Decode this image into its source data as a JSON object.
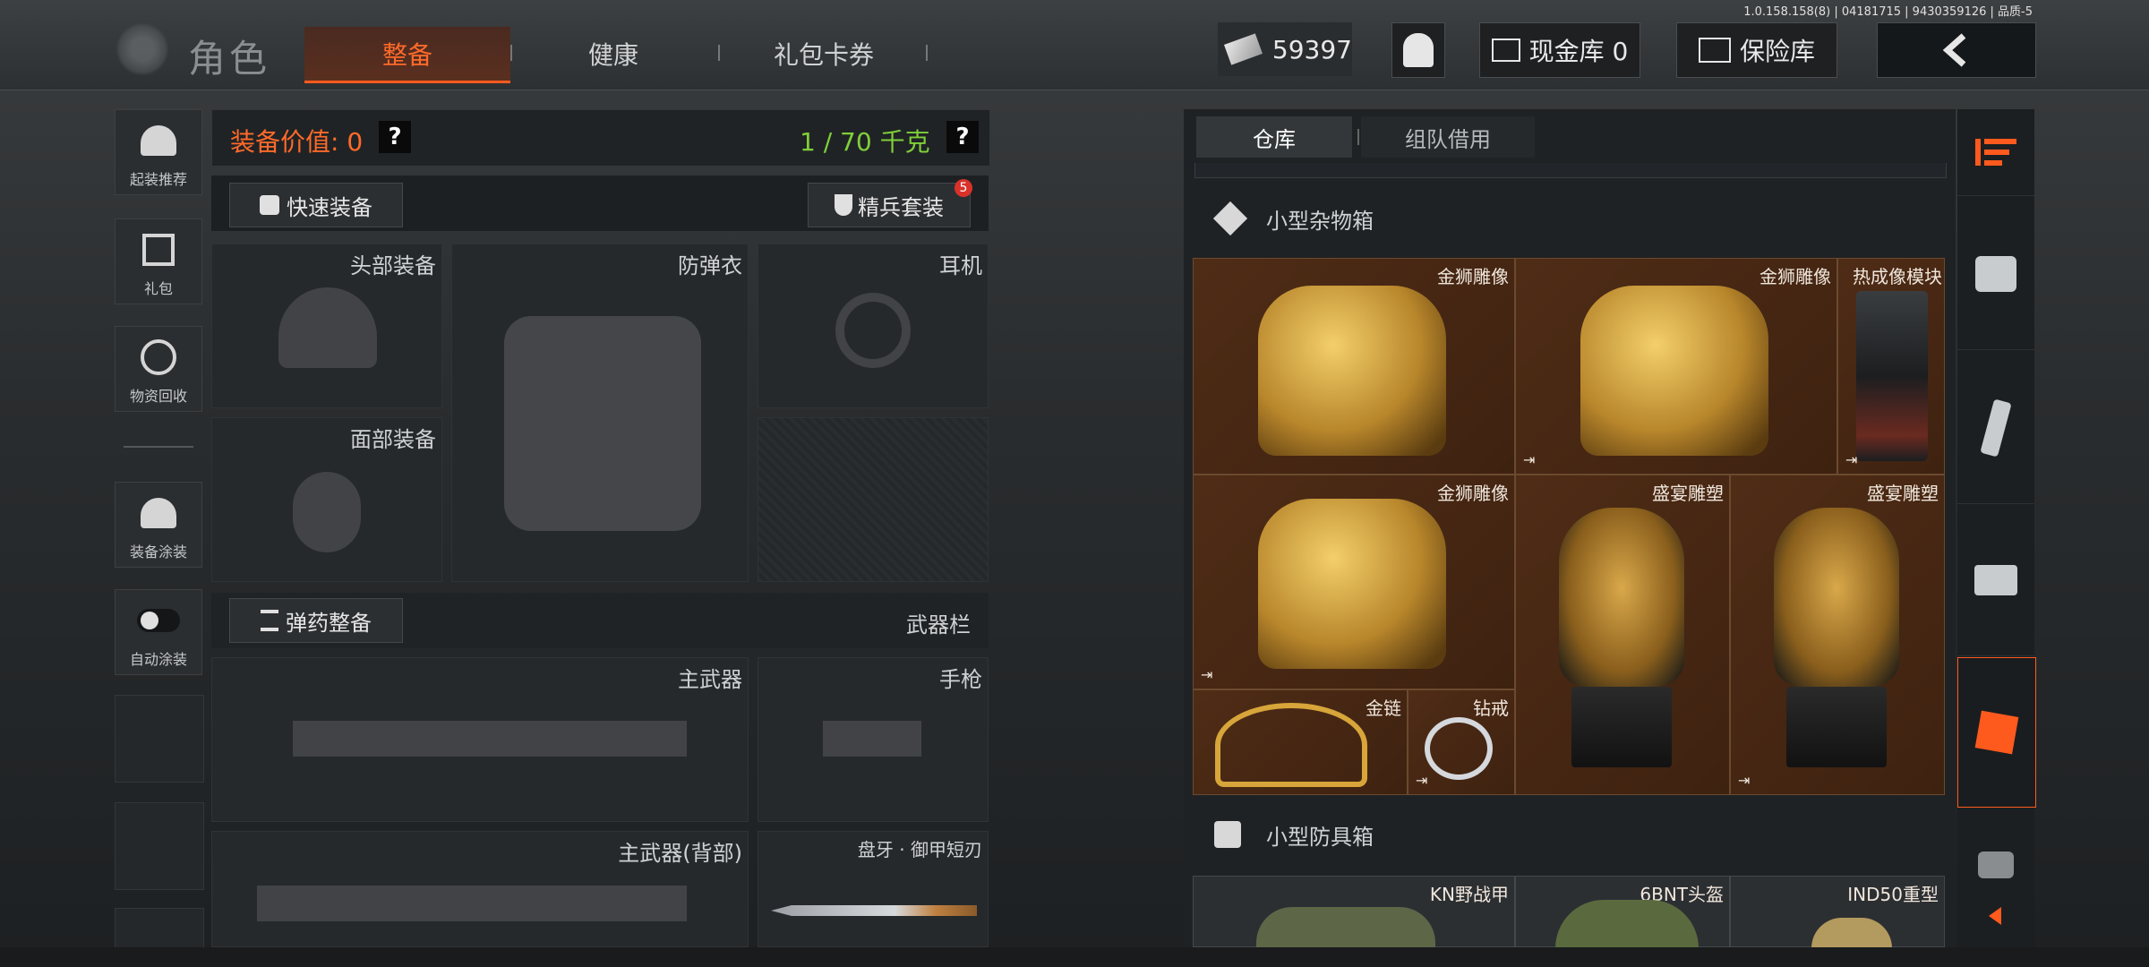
{
  "version_text": "1.0.158.158(8) | 04181715 | 9430359126 | 品质-5",
  "header": {
    "title": "角色",
    "tabs": [
      {
        "label": "整备",
        "active": true
      },
      {
        "label": "健康",
        "active": false
      },
      {
        "label": "礼包卡券",
        "active": false
      }
    ],
    "currency": "59397",
    "cash_storage": "现金库 0",
    "safe_box": "保险库"
  },
  "left_rail": [
    {
      "label": "起装推荐",
      "icon": "helmet-gear-icon"
    },
    {
      "label": "礼包",
      "icon": "gift-icon"
    },
    {
      "label": "物资回收",
      "icon": "recycle-icon"
    },
    {
      "label": "装备涂装",
      "icon": "paint-helmet-icon"
    },
    {
      "label": "自动涂装",
      "icon": "toggle-icon"
    }
  ],
  "equipment": {
    "value_label": "装备价值: 0",
    "weight_label": "1 / 70 千克",
    "quick_equip": "快速装备",
    "elite_kit": "精兵套装",
    "elite_badge": "5",
    "slots": {
      "head": "头部装备",
      "armor": "防弹衣",
      "earphone": "耳机",
      "face": "面部装备"
    },
    "ammo_button": "弹药整备",
    "weapon_bar": "武器栏",
    "weapon_slots": {
      "primary": "主武器",
      "pistol": "手枪",
      "primary_back": "主武器(背部)",
      "melee": "盘牙 · 御甲短刃"
    }
  },
  "inventory": {
    "tabs": [
      {
        "label": "仓库",
        "active": true
      },
      {
        "label": "组队借用",
        "active": false
      }
    ],
    "sections": [
      {
        "title": "小型杂物箱",
        "items": [
          {
            "name": "金狮雕像"
          },
          {
            "name": "金狮雕像"
          },
          {
            "name": "热成像模块"
          },
          {
            "name": "金狮雕像"
          },
          {
            "name": "盛宴雕塑"
          },
          {
            "name": "盛宴雕塑"
          },
          {
            "name": "金链"
          },
          {
            "name": "钻戒"
          }
        ]
      },
      {
        "title": "小型防具箱",
        "items": [
          {
            "name": "KN野战甲"
          },
          {
            "name": "6BNT头盔"
          },
          {
            "name": "IND50重型"
          }
        ]
      }
    ]
  },
  "colors": {
    "accent": "#ff5a1e",
    "weight_green": "#7fcf3a",
    "value_orange": "#ff6a2a",
    "grid_brown": "#4a2a16"
  }
}
